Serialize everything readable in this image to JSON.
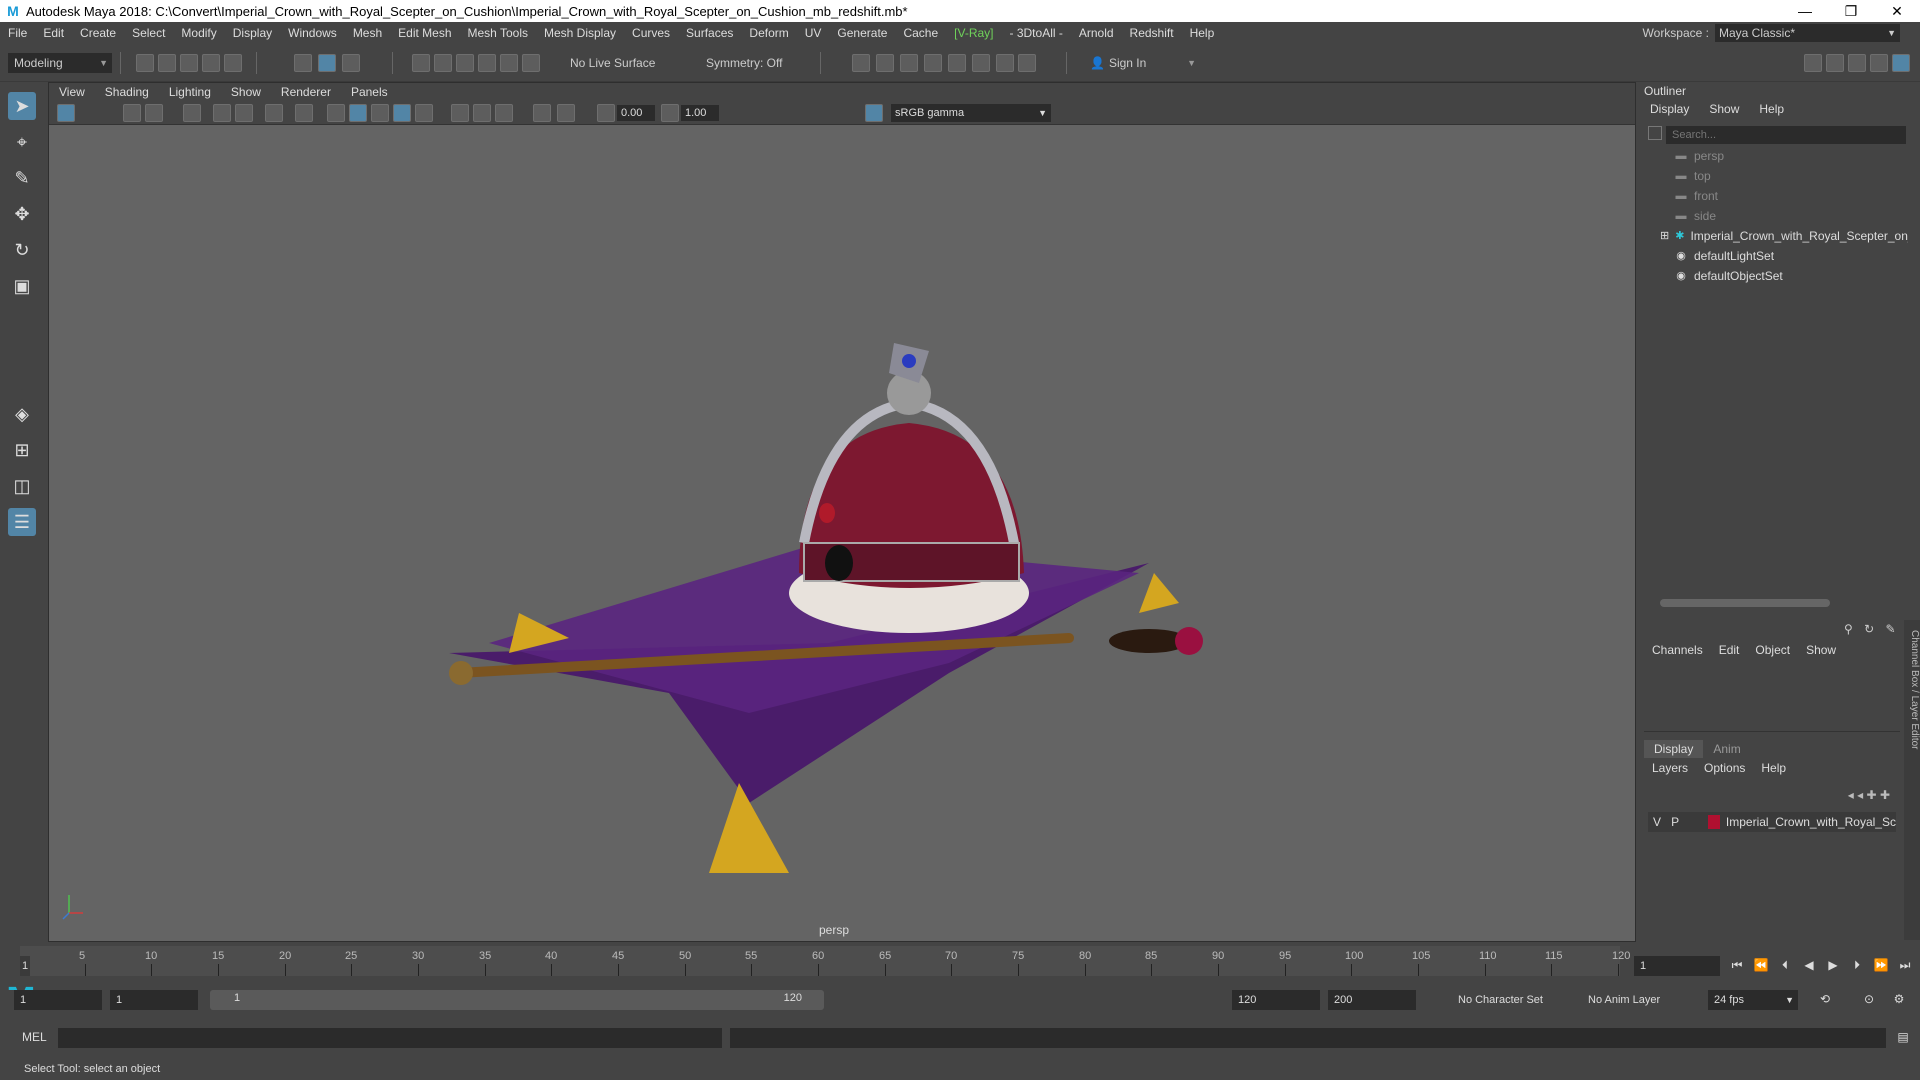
{
  "window": {
    "title": "Autodesk Maya 2018: C:\\Convert\\Imperial_Crown_with_Royal_Scepter_on_Cushion\\Imperial_Crown_with_Royal_Scepter_on_Cushion_mb_redshift.mb*",
    "logo": "M",
    "minimize": "—",
    "restore": "❐",
    "close": "✕"
  },
  "menubar": [
    "File",
    "Edit",
    "Create",
    "Select",
    "Modify",
    "Display",
    "Windows",
    "Mesh",
    "Edit Mesh",
    "Mesh Tools",
    "Mesh Display",
    "Curves",
    "Surfaces",
    "Deform",
    "UV",
    "Generate",
    "Cache",
    "[V-Ray]",
    "- 3DtoAll -",
    "Arnold",
    "Redshift",
    "Help"
  ],
  "workspace": {
    "label": "Workspace :",
    "value": "Maya Classic*"
  },
  "shelf": {
    "mode": "Modeling",
    "live_surface": "No Live Surface",
    "symmetry": "Symmetry: Off",
    "sign_in": "Sign In"
  },
  "viewport": {
    "menu": [
      "View",
      "Shading",
      "Lighting",
      "Show",
      "Renderer",
      "Panels"
    ],
    "exposure": "0.00",
    "gamma_value": "1.00",
    "color_space": "sRGB gamma",
    "camera": "persp"
  },
  "outliner": {
    "title": "Outliner",
    "menu": [
      "Display",
      "Show",
      "Help"
    ],
    "search_placeholder": "Search...",
    "items": [
      {
        "label": "persp",
        "icon": "camera-icon",
        "type": "cam"
      },
      {
        "label": "top",
        "icon": "camera-icon",
        "type": "cam"
      },
      {
        "label": "front",
        "icon": "camera-icon",
        "type": "cam"
      },
      {
        "label": "side",
        "icon": "camera-icon",
        "type": "cam"
      },
      {
        "label": "Imperial_Crown_with_Royal_Scepter_on_",
        "icon": "group-icon",
        "type": "group"
      },
      {
        "label": "defaultLightSet",
        "icon": "set-icon",
        "type": "set"
      },
      {
        "label": "defaultObjectSet",
        "icon": "set-icon",
        "type": "set"
      }
    ]
  },
  "channelbox": {
    "menu": [
      "Channels",
      "Edit",
      "Object",
      "Show"
    ],
    "tabs": [
      "Display",
      "Anim"
    ],
    "layer_menu": [
      "Layers",
      "Options",
      "Help"
    ],
    "layer": {
      "v": "V",
      "p": "P",
      "name": "Imperial_Crown_with_Royal_Sc",
      "color": "#b01030"
    },
    "side_tab": "Channel Box / Layer Editor"
  },
  "timeline": {
    "ticks": [
      "5",
      "10",
      "15",
      "20",
      "25",
      "30",
      "35",
      "40",
      "45",
      "50",
      "55",
      "60",
      "65",
      "70",
      "75",
      "80",
      "85",
      "90",
      "95",
      "100",
      "105",
      "110",
      "115",
      "120"
    ],
    "current_frame": "1",
    "current_field": "1"
  },
  "range": {
    "start": "1",
    "anim_start": "1",
    "slider_start": "1",
    "slider_end": "120",
    "end": "120",
    "anim_end": "200",
    "character_set": "No Character Set",
    "anim_layer": "No Anim Layer",
    "fps": "24 fps"
  },
  "mel": {
    "label": "MEL"
  },
  "helpline": "Select Tool: select an object"
}
